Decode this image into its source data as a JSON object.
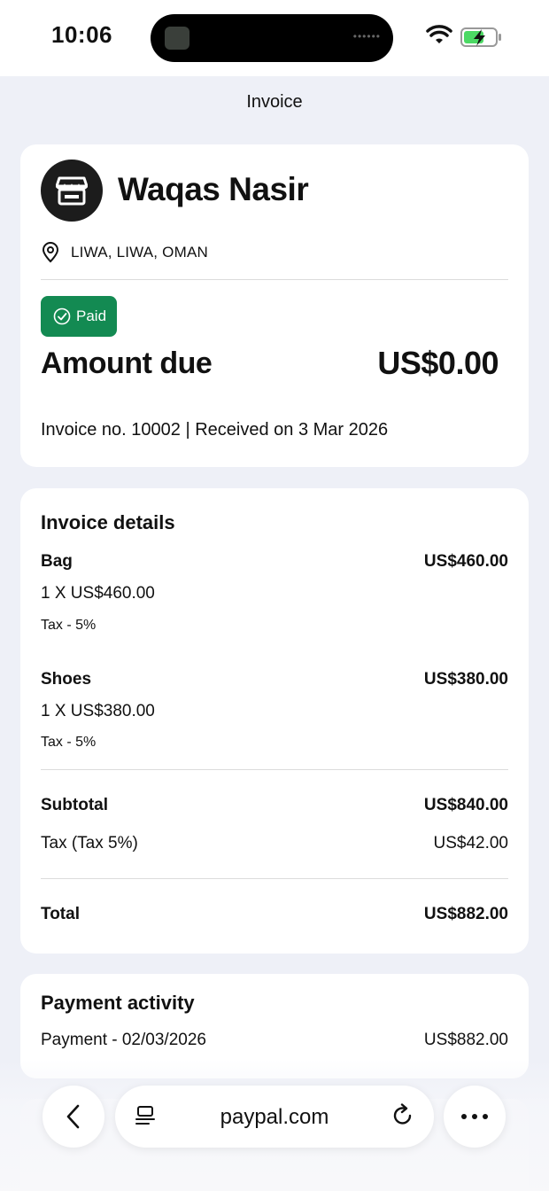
{
  "status_bar": {
    "time": "10:06"
  },
  "header": {
    "title": "Invoice"
  },
  "merchant": {
    "name": "Waqas Nasir",
    "location": "LIWA, LIWA, OMAN",
    "status": "Paid",
    "amount_label": "Amount due",
    "amount_value": "US$0.00",
    "invoice_meta": "Invoice no. 10002 | Received on 3 Mar 2026"
  },
  "details": {
    "title": "Invoice details",
    "items": [
      {
        "name": "Bag",
        "price": "US$460.00",
        "qty": "1 X US$460.00",
        "tax": "Tax - 5%"
      },
      {
        "name": "Shoes",
        "price": "US$380.00",
        "qty": "1 X US$380.00",
        "tax": "Tax - 5%"
      }
    ],
    "subtotal_label": "Subtotal",
    "subtotal_value": "US$840.00",
    "tax_label": "Tax (Tax 5%)",
    "tax_value": "US$42.00",
    "total_label": "Total",
    "total_value": "US$882.00"
  },
  "payment_activity": {
    "title": "Payment activity",
    "entry_label": "Payment - 02/03/2026",
    "entry_value": "US$882.00"
  },
  "browser": {
    "url": "paypal.com"
  },
  "colors": {
    "paid_badge": "#138a52",
    "background": "#eef0f7"
  }
}
